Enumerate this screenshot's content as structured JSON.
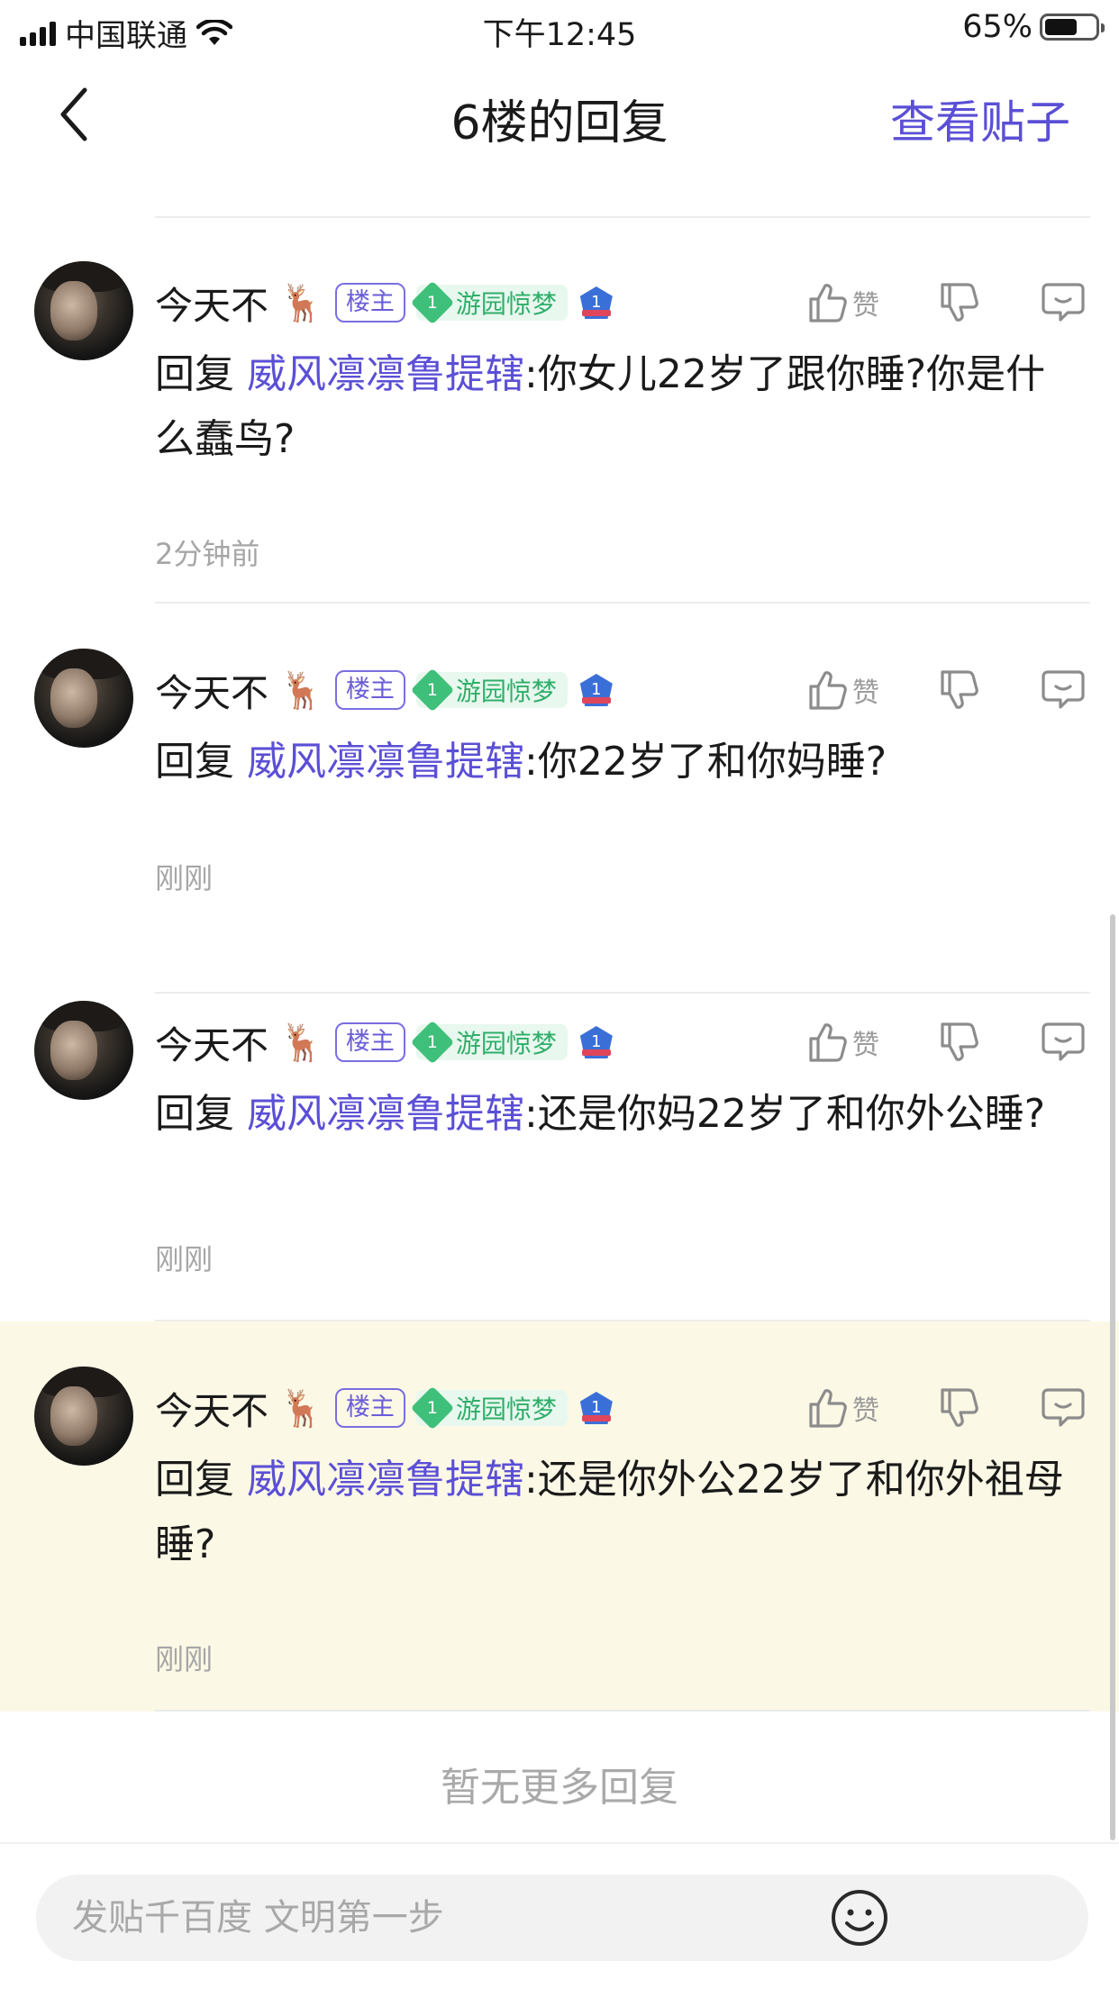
{
  "status_bar": {
    "carrier": "中国联通",
    "time": "下午12:45",
    "battery": "65%",
    "battery_level": 0.65
  },
  "nav": {
    "title": "6楼的回复",
    "action": "查看贴子"
  },
  "replies": [
    {
      "username": "今天不",
      "emoji": "🦌",
      "host_badge": "楼主",
      "level": "1",
      "level_name": "游园惊梦",
      "shield_number": "1",
      "like_label": "赞",
      "prefix": "回复",
      "mention": "威风凛凛鲁提辖",
      "text": ":你女儿22岁了跟你睡?你是什么蠢鸟?",
      "time": "2分钟前"
    },
    {
      "username": "今天不",
      "emoji": "🦌",
      "host_badge": "楼主",
      "level": "1",
      "level_name": "游园惊梦",
      "shield_number": "1",
      "like_label": "赞",
      "prefix": "回复",
      "mention": "威风凛凛鲁提辖",
      "text": ":你22岁了和你妈睡?",
      "time": "刚刚"
    },
    {
      "username": "今天不",
      "emoji": "🦌",
      "host_badge": "楼主",
      "level": "1",
      "level_name": "游园惊梦",
      "shield_number": "1",
      "like_label": "赞",
      "prefix": "回复",
      "mention": "威风凛凛鲁提辖",
      "text": ":还是你妈22岁了和你外公睡?",
      "time": "刚刚"
    },
    {
      "username": "今天不",
      "emoji": "🦌",
      "host_badge": "楼主",
      "level": "1",
      "level_name": "游园惊梦",
      "shield_number": "1",
      "like_label": "赞",
      "prefix": "回复",
      "mention": "威风凛凛鲁提辖",
      "text": ":还是你外公22岁了和你外祖母睡?",
      "time": "刚刚"
    }
  ],
  "no_more": "暂无更多回复",
  "composer": {
    "placeholder": "发贴千百度 文明第一步"
  },
  "colors": {
    "accent": "#5b4fd6",
    "highlight_bg": "#fbf8e6",
    "level_green": "#3fc07a"
  }
}
